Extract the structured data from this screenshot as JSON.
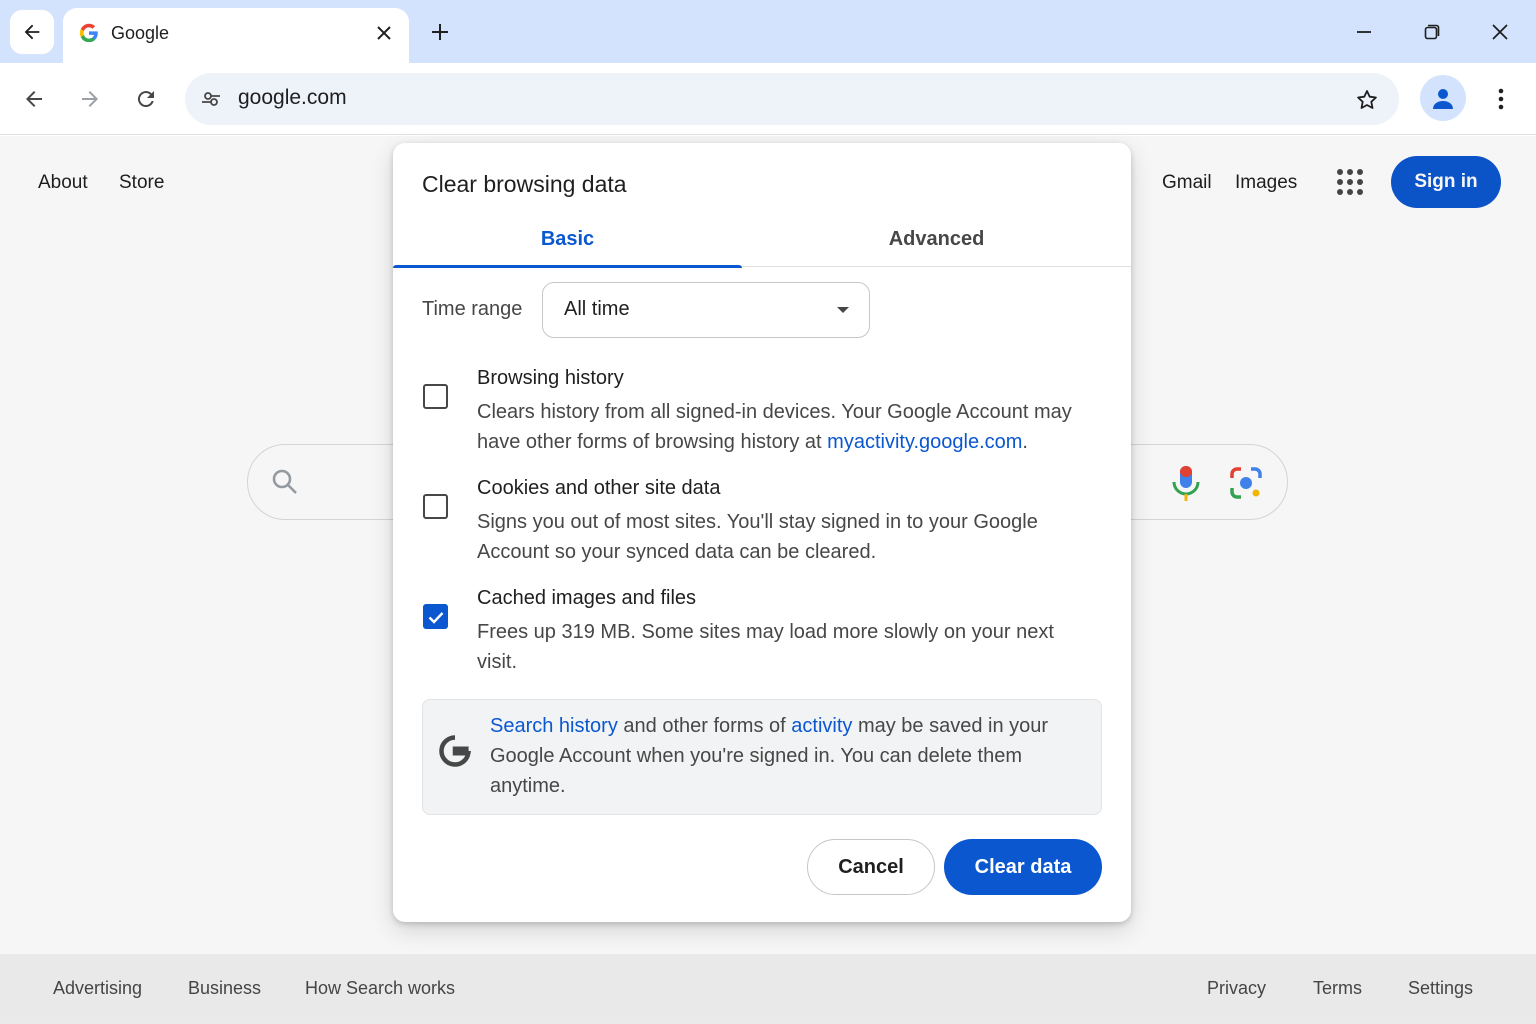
{
  "browser": {
    "tab": {
      "title": "Google"
    },
    "omnibox": {
      "url": "google.com"
    },
    "icons": [
      "tab-search-icon",
      "google-favicon-icon",
      "close-icon",
      "plus-icon",
      "minimize-icon",
      "restore-icon",
      "close-window-icon",
      "back-icon",
      "forward-icon",
      "reload-icon",
      "site-info-icon",
      "bookmark-star-icon",
      "profile-icon",
      "more-menu-icon"
    ]
  },
  "page": {
    "header_left": [
      "About",
      "Store"
    ],
    "header_right": [
      "Gmail",
      "Images"
    ],
    "signin_label": "Sign in",
    "footer_left": [
      "Advertising",
      "Business",
      "How Search works"
    ],
    "footer_right": [
      "Privacy",
      "Terms",
      "Settings"
    ]
  },
  "dialog": {
    "title": "Clear browsing data",
    "tabs": [
      {
        "label": "Basic",
        "active": true
      },
      {
        "label": "Advanced",
        "active": false
      }
    ],
    "time_range": {
      "label": "Time range",
      "value": "All time"
    },
    "items": [
      {
        "title": "Browsing history",
        "desc_1": "Clears history from all signed-in devices. Your Google Account may have other forms of browsing history at ",
        "desc_link": "myactivity.google.com",
        "desc_2": ".",
        "checked": false
      },
      {
        "title": "Cookies and other site data",
        "desc": "Signs you out of most sites. You'll stay signed in to your Google Account so your synced data can be cleared.",
        "checked": false
      },
      {
        "title": "Cached images and files",
        "desc": "Frees up 319 MB. Some sites may load more slowly on your next visit.",
        "checked": true
      }
    ],
    "notice": {
      "link1": "Search history",
      "text1": " and other forms of ",
      "link2": "activity",
      "text2": " may be saved in your Google Account when you're signed in. You can delete them anytime."
    },
    "cancel_label": "Cancel",
    "clear_label": "Clear data"
  },
  "colors": {
    "accent": "#0b57d0",
    "tabstrip": "#d3e3fd",
    "omnibox": "#eef2f9"
  }
}
